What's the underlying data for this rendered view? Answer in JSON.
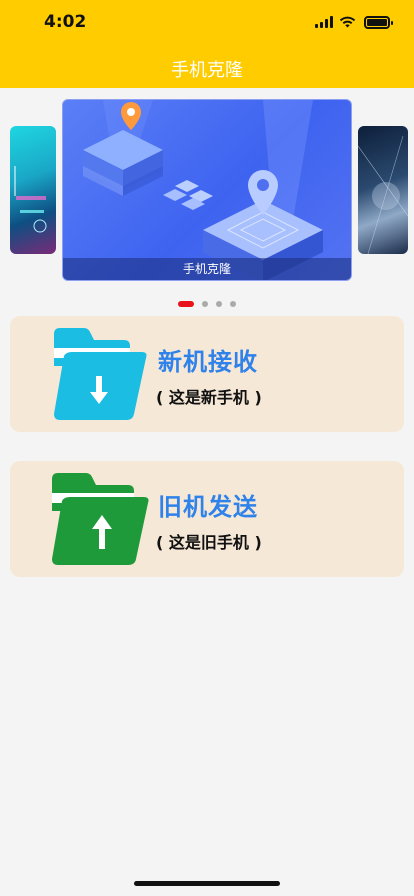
{
  "status_bar": {
    "time": "4:02",
    "icons": [
      "signal-icon",
      "wifi-icon",
      "battery-icon"
    ]
  },
  "header": {
    "title": "手机克隆",
    "background": "#ffcc00"
  },
  "carousel": {
    "caption": "手机克隆",
    "dots": 4,
    "active_index": 0,
    "active_color": "#e8121b"
  },
  "cards": [
    {
      "title": "新机接收",
      "subtitle": "( 这是新手机 )",
      "icon": "folder-download-icon",
      "icon_color": "#1bbde3"
    },
    {
      "title": "旧机发送",
      "subtitle": "( 这是旧手机 )",
      "icon": "folder-upload-icon",
      "icon_color": "#1e9a3a"
    }
  ],
  "colors": {
    "card_background": "#f6e8d6",
    "title_blue": "#2f82ea",
    "page_background": "#f4f4f4"
  }
}
